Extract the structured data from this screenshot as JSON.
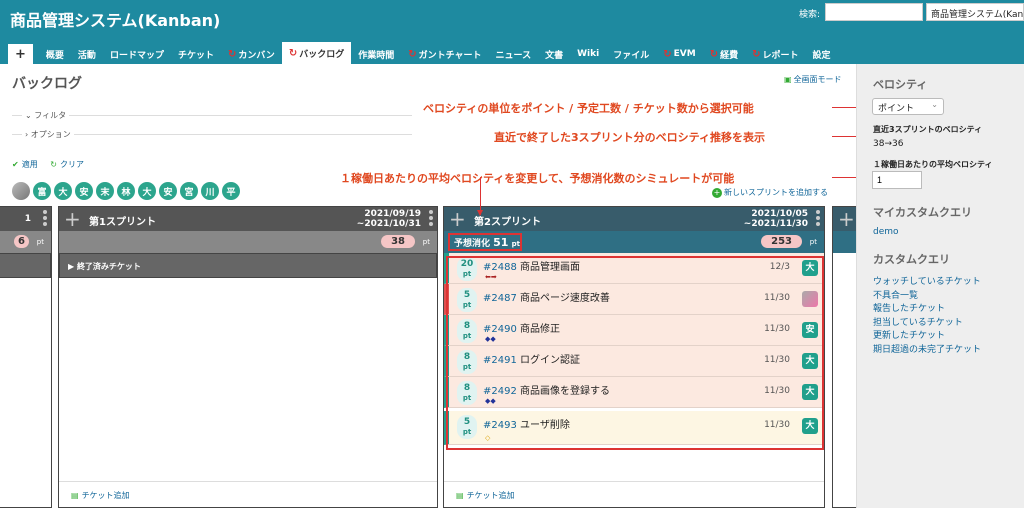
{
  "header": {
    "title": "商品管理システム(Kanban)",
    "search_label": "検索:",
    "search_value": "",
    "project_select": "商品管理システム(Kanban"
  },
  "tabs": [
    {
      "label": "+"
    },
    {
      "label": "概要"
    },
    {
      "label": "活動"
    },
    {
      "label": "ロードマップ"
    },
    {
      "label": "チケット"
    },
    {
      "label": "カンバン",
      "icon": "refresh-icon"
    },
    {
      "label": "バックログ",
      "icon": "refresh-icon",
      "active": true
    },
    {
      "label": "作業時間"
    },
    {
      "label": "ガントチャート",
      "icon": "refresh-icon"
    },
    {
      "label": "ニュース"
    },
    {
      "label": "文書"
    },
    {
      "label": "Wiki"
    },
    {
      "label": "ファイル"
    },
    {
      "label": "EVM",
      "icon": "refresh-icon"
    },
    {
      "label": "経費",
      "icon": "refresh-icon"
    },
    {
      "label": "レポート",
      "icon": "refresh-icon"
    },
    {
      "label": "設定"
    }
  ],
  "main": {
    "page_title": "バックログ",
    "fullscreen": "全画面モード",
    "filter": "フィルタ",
    "options": "オプション",
    "apply": "適用",
    "clear": "クリア",
    "avatars": [
      "",
      "富",
      "大",
      "安",
      "末",
      "林",
      "大",
      "安",
      "宮",
      "川",
      "平"
    ],
    "add_sprint": "新しいスプリントを追加する"
  },
  "columns": {
    "prev": {
      "dates_end": "1",
      "points": "6",
      "pt": "pt"
    },
    "sprint1": {
      "name": "第1スプリント",
      "date_start": "2021/09/19",
      "date_end": "~2021/10/31",
      "points": "38",
      "pt": "pt",
      "closed": "終了済みチケット",
      "add_ticket": "チケット追加"
    },
    "sprint2": {
      "name": "第2スプリント",
      "date_start": "2021/10/05",
      "date_end": "~2021/11/30",
      "points": "253",
      "pt": "pt",
      "forecast_label": "予想消化",
      "forecast_value": "51",
      "forecast_unit": "pt",
      "add_ticket": "チケット追加",
      "tickets": [
        {
          "pts": "20",
          "unit": "pt",
          "id": "#2488",
          "title": "商品管理画面",
          "due": "12/3",
          "assignee": "大",
          "arrows": "⬅➡"
        },
        {
          "pts": "5",
          "unit": "pt",
          "id": "#2487",
          "title": "商品ページ速度改善",
          "due": "11/30",
          "assignee": "",
          "arrows": ""
        },
        {
          "pts": "8",
          "unit": "pt",
          "id": "#2490",
          "title": "商品修正",
          "due": "11/30",
          "assignee": "安",
          "arrows": "◆◆"
        },
        {
          "pts": "8",
          "unit": "pt",
          "id": "#2491",
          "title": "ログイン認証",
          "due": "11/30",
          "assignee": "大",
          "arrows": ""
        },
        {
          "pts": "8",
          "unit": "pt",
          "id": "#2492",
          "title": "商品画像を登録する",
          "due": "11/30",
          "assignee": "大",
          "arrows": "◆◆"
        },
        {
          "pts": "5",
          "unit": "pt",
          "id": "#2493",
          "title": "ユーザ削除",
          "due": "11/30",
          "assignee": "大",
          "arrows": "◇"
        }
      ]
    }
  },
  "annotations": {
    "a1": "ベロシティの単位をポイント / 予定工数 / チケット数から選択可能",
    "a2": "直近で終了した3スプリント分のベロシティ推移を表示",
    "a3": "１稼働日あたりの平均ベロシティを変更して、予想消化数のシミュレートが可能"
  },
  "sidebar": {
    "velocity_title": "ベロシティ",
    "unit_value": "ポイント",
    "recent_label": "直近3スプリントのベロシティ",
    "recent_value": "38→36",
    "avg_label": "１稼働日あたりの平均ベロシティ",
    "avg_value": "1",
    "my_query_title": "マイカスタムクエリ",
    "my_query_item": "demo",
    "custom_query_title": "カスタムクエリ",
    "custom_queries": [
      "ウォッチしているチケット",
      "不具合一覧",
      "報告したチケット",
      "担当しているチケット",
      "更新したチケット",
      "期日超過の未完了チケット"
    ]
  },
  "colors": {
    "header": "#1e8aa0",
    "accent": "#d33",
    "assignee": "#20a08c"
  }
}
